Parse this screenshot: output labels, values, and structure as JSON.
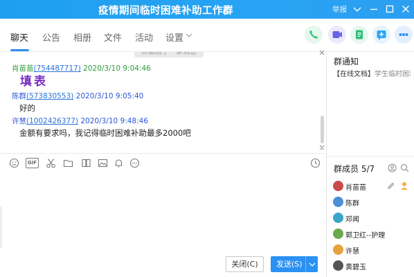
{
  "window": {
    "title": "疫情期间临时困难补助工作群",
    "report_label": "举报"
  },
  "tabs": [
    {
      "label": "聊天",
      "active": true
    },
    {
      "label": "公告"
    },
    {
      "label": "相册"
    },
    {
      "label": "文件"
    },
    {
      "label": "活动"
    },
    {
      "label": "设置"
    }
  ],
  "header_actions": [
    {
      "icon": "phone-icon",
      "color": "#2fc27a"
    },
    {
      "icon": "video-icon",
      "color": "#6a63e8"
    },
    {
      "icon": "document-icon",
      "color": "#2fbf76"
    },
    {
      "icon": "add-app-icon",
      "color": "#2fa4f2"
    },
    {
      "icon": "more-icon",
      "color": "#2f8df4"
    }
  ],
  "chat": {
    "withdraw_notice": "你撤回了一条消息",
    "messages": [
      {
        "sender": "肖苗苗",
        "id": "(754487717)",
        "time": "2020/3/10 9:04:46",
        "text": "填表",
        "name_color": "#2b9b3a"
      },
      {
        "sender": "陈群",
        "id": "(573830553)",
        "time": "2020/3/10 9:05:40",
        "text": "好的",
        "name_color": "#2b57d8"
      },
      {
        "sender": "许慧",
        "id": "(1002426377)",
        "time": "2020/3/10 9:48:46",
        "text": "金额有要求吗，我记得临时困难补助最多2000吧",
        "name_color": "#2b57d8"
      }
    ]
  },
  "toolbar": {
    "icons": [
      "emoji-icon",
      "gif-icon",
      "scissors-icon",
      "folder-icon",
      "image-group-icon",
      "picture-icon",
      "bell-icon",
      "more-dots-icon",
      "clock-icon"
    ],
    "gif_label": "GIF"
  },
  "buttons": {
    "close_label": "关闭(C)",
    "send_label": "发送(S)"
  },
  "group_notice": {
    "title": "群通知",
    "tag": "【在线文档】",
    "text": "学生临时困难补助"
  },
  "members": {
    "title": "群成员 5/7",
    "list": [
      {
        "name": "肖苗苗",
        "avatar_color": "#c94b4b"
      },
      {
        "name": "陈群",
        "avatar_color": "#4a8fd8"
      },
      {
        "name": "邓闻",
        "avatar_color": "#3aa6c7"
      },
      {
        "name": "郭卫红--护理",
        "avatar_color": "#6aa84f"
      },
      {
        "name": "许慧",
        "avatar_color": "#e6a23c"
      },
      {
        "name": "黄碧玉",
        "avatar_color": "#555555"
      }
    ]
  }
}
